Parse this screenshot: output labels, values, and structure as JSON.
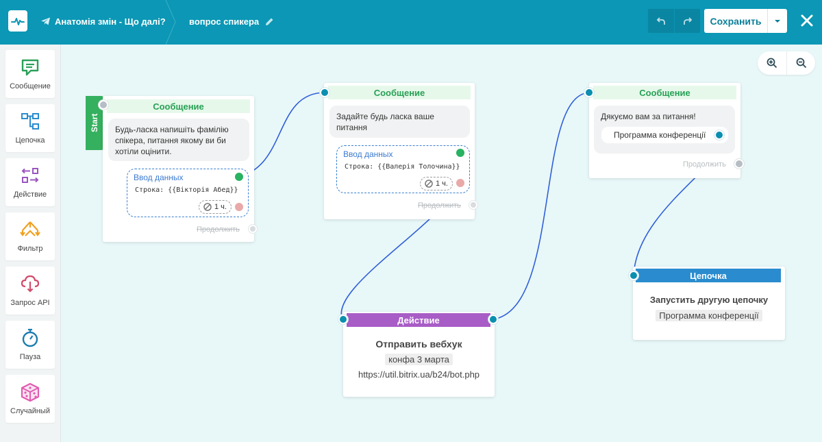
{
  "header": {
    "project": "Анатомія змін - Що далі?",
    "chain_name": "вопрос спикера",
    "save_label": "Сохранить"
  },
  "sidebar": {
    "items": [
      {
        "label": "Сообщение",
        "icon": "message-icon",
        "color": "#2aa05a"
      },
      {
        "label": "Цепочка",
        "icon": "chain-icon",
        "color": "#2a8ccf"
      },
      {
        "label": "Действие",
        "icon": "action-icon",
        "color": "#9a55c0"
      },
      {
        "label": "Фильтр",
        "icon": "filter-icon",
        "color": "#f0a020"
      },
      {
        "label": "Запрос API",
        "icon": "api-cloud-icon",
        "color": "#d24b6a"
      },
      {
        "label": "Пауза",
        "icon": "stopwatch-icon",
        "color": "#1a7cae"
      },
      {
        "label": "Случайный",
        "icon": "dice-icon",
        "color": "#e05cb0"
      }
    ]
  },
  "nodes": {
    "msg1": {
      "start": "Start",
      "title": "Сообщение",
      "text": "Будь-ласка напишіть фамілію спікера, питання якому ви би хотіли оцінити.",
      "input_title": "Ввод данных",
      "input_value": "Строка: {{Вікторія Абед}}",
      "timer": "1 ч.",
      "continue": "Продолжить"
    },
    "msg2": {
      "title": "Сообщение",
      "text": "Задайте будь ласка ваше питання",
      "input_title": "Ввод данных",
      "input_value": "Строка: {{Валерія Толочина}}",
      "timer": "1 ч.",
      "continue": "Продолжить"
    },
    "msg3": {
      "title": "Сообщение",
      "text": "Дякуємо вам за питання!",
      "button": "Программа конференції",
      "continue": "Продолжить"
    },
    "action": {
      "title": "Действие",
      "action_name": "Отправить вебхук",
      "tag": "конфа 3 марта",
      "url": "https://util.bitrix.ua/b24/bot.php"
    },
    "chain": {
      "title": "Цепочка",
      "action_name": "Запустить другую цепочку",
      "target": "Программа конференції"
    }
  }
}
